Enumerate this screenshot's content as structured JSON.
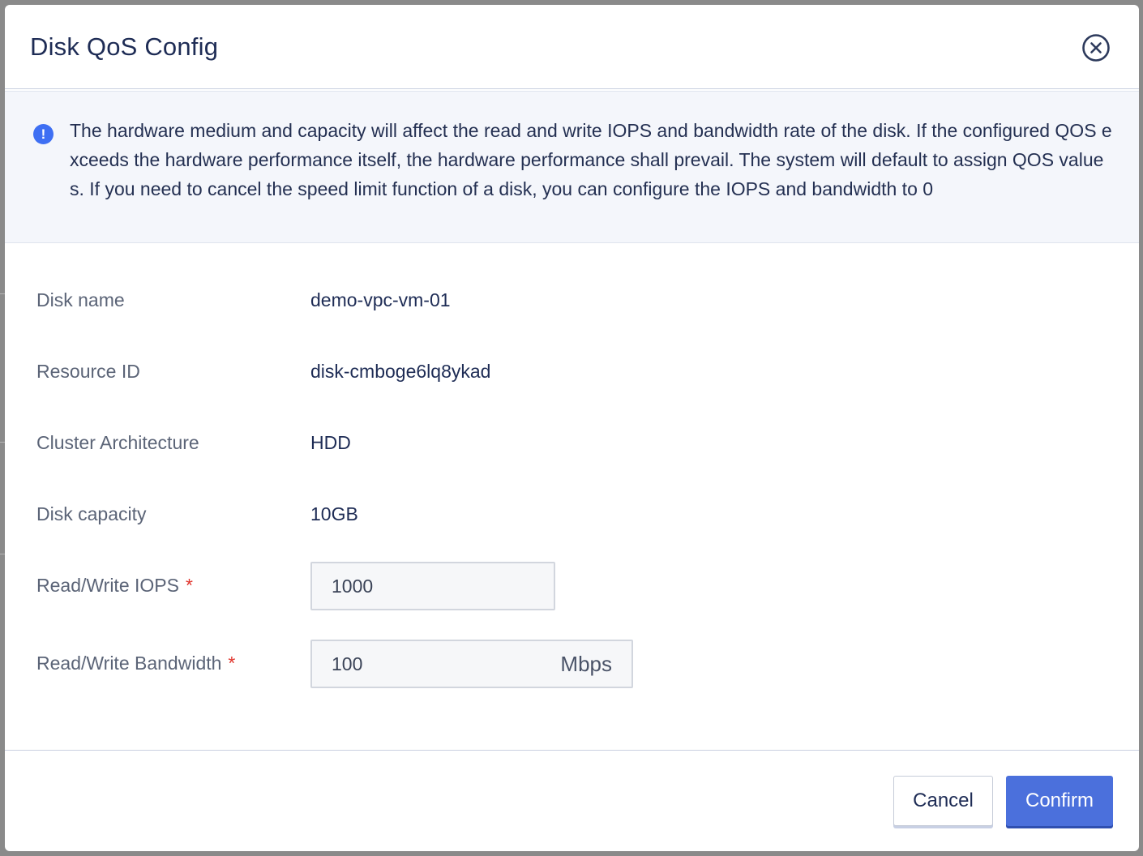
{
  "dialog": {
    "title": "Disk QoS Config"
  },
  "notice": {
    "text": "The hardware medium and capacity will affect the read and write IOPS and bandwidth rate of the disk. If the configured QOS exceeds the hardware performance itself, the hardware performance shall prevail. The system will default to assign QOS values. If you need to cancel the speed limit function of a disk, you can configure the IOPS and bandwidth to 0"
  },
  "details": [
    {
      "label": "Disk name",
      "value": "demo-vpc-vm-01"
    },
    {
      "label": "Resource ID",
      "value": "disk-cmboge6lq8ykad"
    },
    {
      "label": "Cluster Architecture",
      "value": "HDD"
    },
    {
      "label": "Disk capacity",
      "value": "10GB"
    }
  ],
  "form": {
    "iops": {
      "label": "Read/Write IOPS",
      "required_mark": "*",
      "value": "1000"
    },
    "bandwidth": {
      "label": "Read/Write Bandwidth",
      "required_mark": "*",
      "value": "100",
      "unit": "Mbps"
    }
  },
  "buttons": {
    "cancel": "Cancel",
    "confirm": "Confirm"
  },
  "colors": {
    "accent": "#4b70dc",
    "info_icon": "#3e6ff3",
    "required": "#e0352d",
    "title_text": "#1e2c55"
  },
  "icons": {
    "close": "close-circle-icon",
    "notice": "info-exclamation-icon"
  }
}
